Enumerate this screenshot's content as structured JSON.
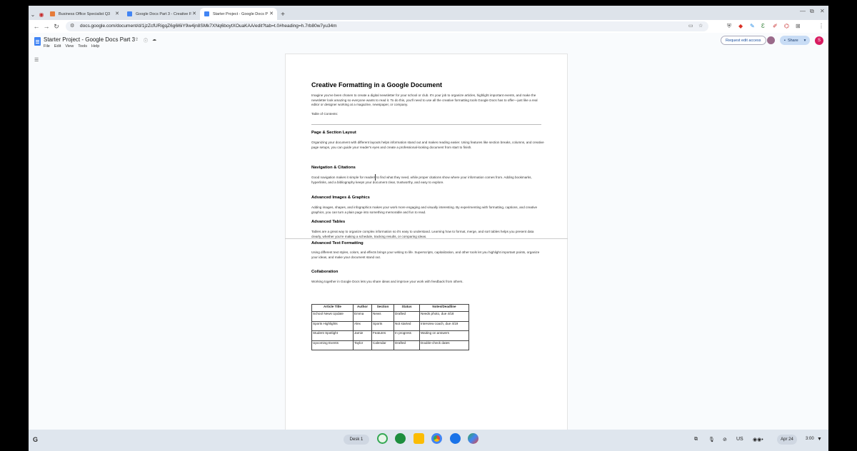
{
  "browser": {
    "tabs": [
      {
        "label": "Business Office Specialist Q3",
        "fav_color": "#e67c3a",
        "active": false
      },
      {
        "label": "Google Docs Part 3 - Creative F",
        "fav_color": "#4285f4",
        "active": false
      },
      {
        "label": "Starter Project - Google Docs P",
        "fav_color": "#4285f4",
        "active": true
      }
    ],
    "url": "docs.google.com/document/d/1jzZcfURigqZ6g6l6iY9w4jn8SMk7XNq6boytXOuaKAA/edit?tab=t.0#heading=h.7rb80w7yu34m"
  },
  "docs": {
    "title": "Starter Project - Google Docs Part 3",
    "menu": [
      "File",
      "Edit",
      "View",
      "Tools",
      "Help"
    ],
    "request_edit_access": "Request edit access",
    "share_label": "Share",
    "avatar_letter": "S"
  },
  "document": {
    "title": "Creative Formatting in a Google Document",
    "intro": "Imagine you've been chosen to create a digital newsletter for your school or club. It's your job to organize articles, highlight important events, and make the newsletter look amazing so everyone wants to read it. To do this, you'll need to use all the creative formatting tools Google Docs has to offer—just like a real editor or designer working at a magazine, newspaper, or company.",
    "toc_label": "Table of Contents:",
    "sections": [
      {
        "heading": "Page & Section Layout",
        "body": "Organizing your document with different layouts helps information stand out and makes reading easier. Using features like section breaks, columns, and creative page setups, you can guide your reader's eyes and create a professional-looking document from start to finish."
      },
      {
        "heading": "Navigation & Citations",
        "body": "Good navigation makes it simple for readers to find what they need, while proper citations show where your information comes from. Adding bookmarks, hyperlinks, and a bibliography keeps your document clear, trustworthy, and easy to explore."
      },
      {
        "heading": "Advanced Images & Graphics",
        "body": "Adding images, shapes, and infographics makes your work more engaging and visually interesting. By experimenting with formatting, captions, and creative graphics, you can turn a plain page into something memorable and fun to read."
      },
      {
        "heading": "Advanced Tables",
        "body": "Tables are a great way to organize complex information so it's easy to understand. Learning how to format, merge, and sort tables helps you present data clearly, whether you're making a schedule, tracking results, or comparing ideas."
      },
      {
        "heading": "Advanced Text Formatting",
        "body": "Using different text styles, colors, and effects brings your writing to life. Superscripts, capitalization, and other tools let you highlight important points, organize your ideas, and make your document stand out."
      },
      {
        "heading": "Collaboration",
        "body": "Working together in Google Docs lets you share ideas and improve your work with feedback from others."
      }
    ],
    "table": {
      "headers": [
        "Article Title",
        "Author",
        "Section",
        "Status",
        "Notes/Deadline"
      ],
      "rows": [
        [
          "School News Update",
          "Emma",
          "News",
          "Drafted",
          "Needs photo, due 4/18"
        ],
        [
          "Sports Highlights",
          "Alex",
          "Sports",
          "Not started",
          "Interview coach, due 4/19"
        ],
        [
          "Student Spotlight",
          "Jamie",
          "Features",
          "In progress",
          "Waiting on answers"
        ],
        [
          "Upcoming Events",
          "Taylor",
          "Calendar",
          "Drafted",
          "Double-check dates"
        ]
      ]
    }
  },
  "shelf": {
    "launcher": "G",
    "desk_label": "Desk 1",
    "ime": "US",
    "date": "Apr 24",
    "time": "3:00"
  }
}
